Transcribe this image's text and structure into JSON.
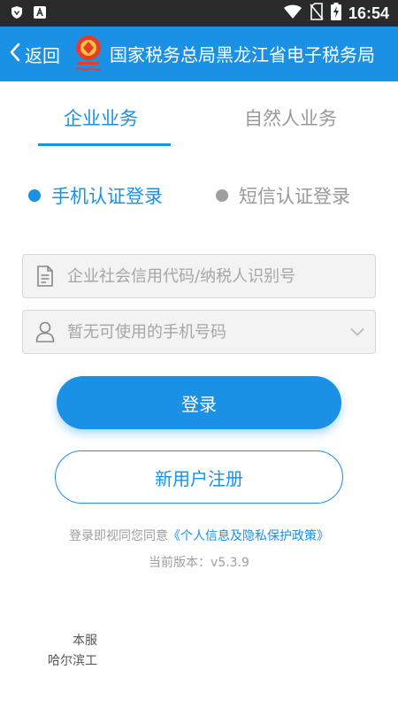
{
  "status_bar": {
    "time": "16:54",
    "icons": [
      "shield-icon",
      "a-notification-icon",
      "wifi-icon",
      "no-sim-icon",
      "battery-charging-icon"
    ]
  },
  "header": {
    "back_label": "返回",
    "title": "国家税务总局黑龙江省电子税务局",
    "emblem": "tax-emblem-icon",
    "background": "#1b91e6"
  },
  "tabs": [
    {
      "label": "企业业务",
      "active": true
    },
    {
      "label": "自然人业务",
      "active": false
    }
  ],
  "login_methods": [
    {
      "label": "手机认证登录",
      "selected": true,
      "color": "#1b91e6"
    },
    {
      "label": "短信认证登录",
      "selected": false,
      "color": "#9e9e9e"
    }
  ],
  "form": {
    "credit_code_placeholder": "企业社会信用代码/纳税人识别号",
    "phone_placeholder": "暂无可使用的手机号码"
  },
  "buttons": {
    "login": "登录",
    "register": "新用户注册"
  },
  "agreement": {
    "text": "登录即视同您同意",
    "link": "《个人信息及隐私保护政策》"
  },
  "version": "当前版本：v5.3.9",
  "footer": {
    "line1": "本服",
    "line2": "哈尔滨工"
  },
  "colors": {
    "accent": "#1b91e6",
    "muted": "#9e9e9e",
    "field_background": "#f3f3f3"
  }
}
